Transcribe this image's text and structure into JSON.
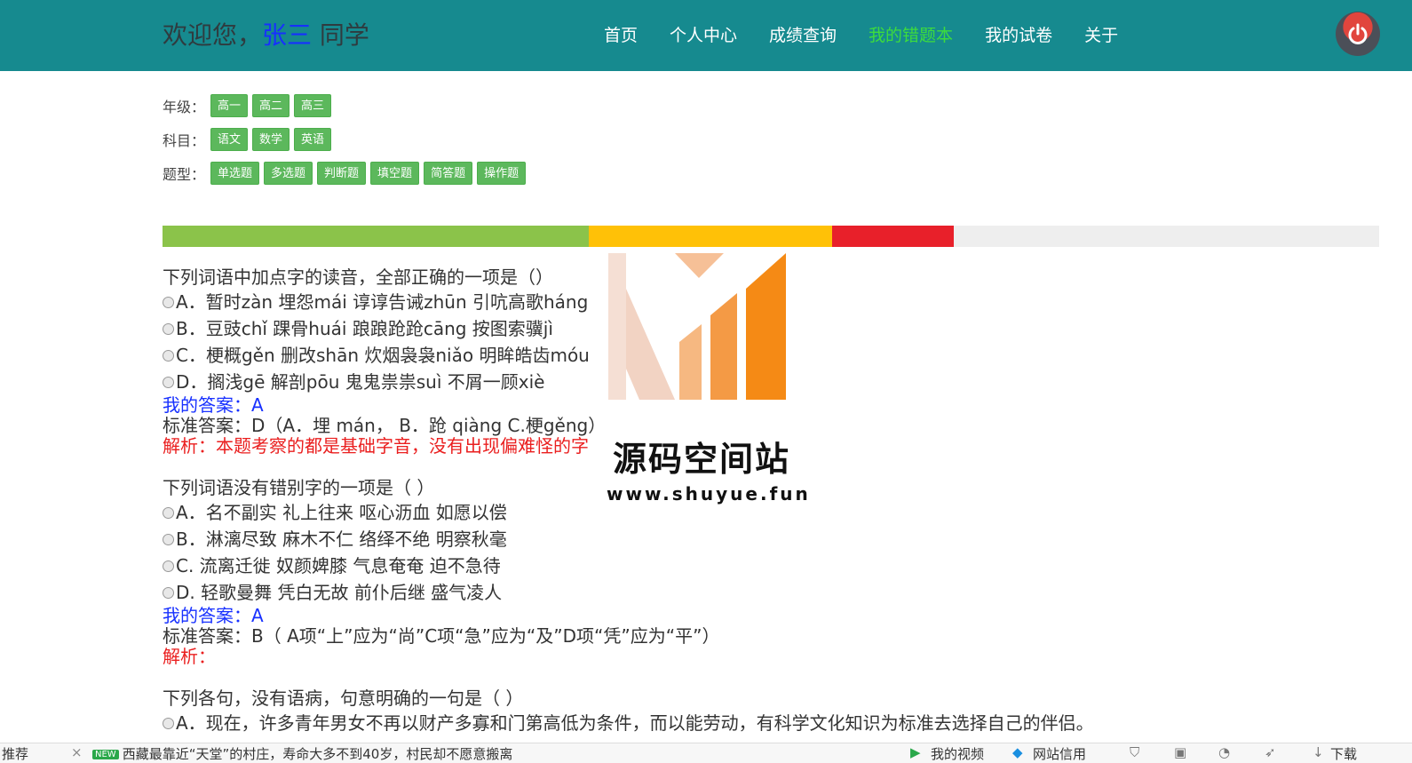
{
  "header": {
    "welcome_prefix": "欢迎您，",
    "user_name": "张三",
    "welcome_suffix": " 同学",
    "nav": [
      {
        "label": "首页"
      },
      {
        "label": "个人中心"
      },
      {
        "label": "成绩查询"
      },
      {
        "label": "我的错题本"
      },
      {
        "label": "我的试卷"
      },
      {
        "label": "关于"
      }
    ],
    "active_nav": "我的错题本",
    "power_icon": "power-icon"
  },
  "filters": {
    "grade": {
      "label": "年级：",
      "options": [
        "高一",
        "高二",
        "高三"
      ]
    },
    "subject": {
      "label": "科目：",
      "options": [
        "语文",
        "数学",
        "英语"
      ]
    },
    "type": {
      "label": "题型：",
      "options": [
        "单选题",
        "多选题",
        "判断题",
        "填空题",
        "简答题",
        "操作题"
      ]
    }
  },
  "progress": {
    "segments": [
      {
        "color": "#8bc34a",
        "fraction": 0.35
      },
      {
        "color": "#ffc107",
        "fraction": 0.2
      },
      {
        "color": "#e8202a",
        "fraction": 0.1
      }
    ]
  },
  "questions": [
    {
      "title": "下列词语中加点字的读音，全部正确的一项是（）",
      "options": [
        "A．暂时zàn 埋怨mái 谆谆告诫zhūn 引吭高歌háng",
        "B．豆豉chǐ 踝骨huái 踉踉跄跄cāng 按图索骥jì",
        "C．梗概gěn 删改shān 炊烟袅袅niǎo 明眸皓齿móu",
        "D．搁浅gē 解剖pōu 鬼鬼祟祟suì 不屑一顾xiè"
      ],
      "my_answer": "我的答案：A",
      "standard_answer": "标准答案：D（A．埋 mán， B．跄 qiàng C.梗gěng）",
      "analysis": "解析：本题考察的都是基础字音，没有出现偏难怪的字"
    },
    {
      "title": "下列词语没有错别字的一项是（ ）",
      "options": [
        "A．名不副实 礼上往来 呕心沥血 如愿以偿",
        "B．淋漓尽致 麻木不仁 络绎不绝 明察秋毫",
        "C. 流离迁徙 奴颜婢膝 气息奄奄 迫不急待",
        "D. 轻歌曼舞 凭白无故 前仆后继 盛气凌人"
      ],
      "my_answer": "我的答案：A",
      "standard_answer": "标准答案：B（ A项“上”应为“尚”C项“急”应为“及”D项“凭”应为“平”）",
      "analysis": "解析："
    },
    {
      "title": "下列各句，没有语病，句意明确的一句是（ ）",
      "options": [
        "A．现在，许多青年男女不再以财产多寡和门第高低为条件，而以能劳动，有科学文化知识为标准去选择自己的伴侣。"
      ],
      "my_answer": "",
      "standard_answer": "",
      "analysis": ""
    }
  ],
  "watermark": {
    "title": "源码空间站",
    "url": "www.shuyue.fun"
  },
  "statusbar": {
    "recommend": "推荐",
    "new_badge": "NEW",
    "news": "西藏最靠近“天堂”的村庄，寿命大多不到40岁，村民却不愿意搬离",
    "my_video": "我的视频",
    "site_credit": "网站信用",
    "download": "下载"
  }
}
